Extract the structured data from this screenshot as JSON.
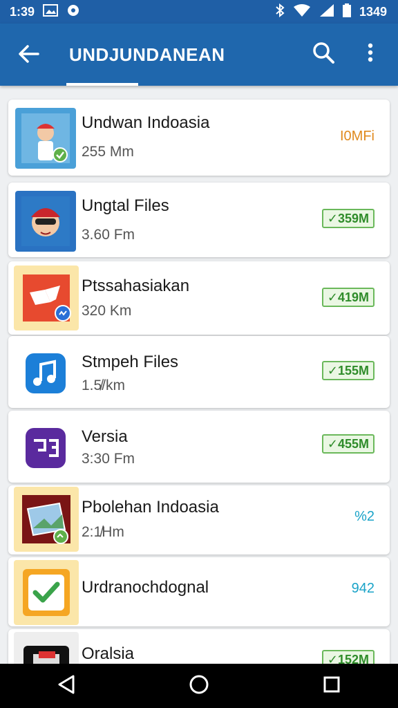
{
  "status_bar": {
    "time": "1:39",
    "battery_text": "1349",
    "icons": [
      "image-icon",
      "record-icon",
      "bluetooth-icon",
      "wifi-icon",
      "signal-icon",
      "battery-icon"
    ]
  },
  "app_bar": {
    "title": "UNDJUNDANEAN",
    "icons": [
      "back-arrow-icon",
      "search-icon",
      "more-vert-icon"
    ]
  },
  "items": [
    {
      "name": "Undwan Indoasia",
      "meta": "255 Mm",
      "size": "I0MFi",
      "size_style": "orange",
      "icon": "character-app-icon"
    },
    {
      "name": "Ungtal Files",
      "meta": "3.60 Fm",
      "size": "✓359M",
      "size_style": "badge",
      "icon": "character-app-icon"
    },
    {
      "name": "Ptssahasiakan",
      "meta": "320 Km",
      "size": "✓419M",
      "size_style": "badge",
      "icon": "red-flag-app-icon"
    },
    {
      "name": "Stmpeh Files",
      "meta": "1.5̸/km",
      "size": "✓155M",
      "size_style": "badge",
      "icon": "music-note-icon"
    },
    {
      "name": "Versia",
      "meta": "3:30 Fm",
      "size": "✓455M",
      "size_style": "badge",
      "icon": "purple-app-icon"
    },
    {
      "name": "Pbolehan Indoasia",
      "meta": "2:1̸Hm",
      "size": "%2",
      "size_style": "teal",
      "icon": "photo-app-icon"
    },
    {
      "name": "Urdranochdognal",
      "meta": "",
      "size": "942",
      "size_style": "teal",
      "icon": "checkmark-app-icon"
    },
    {
      "name": "Oralsia",
      "meta": "",
      "size": "✓152M",
      "size_style": "badge",
      "icon": "dark-app-icon"
    }
  ],
  "nav_bar": {
    "icons": [
      "back-triangle-icon",
      "home-circle-icon",
      "recents-square-icon"
    ]
  },
  "colors": {
    "primary": "#1f67ad",
    "status_bar": "#1f5fa6",
    "badge_green": "#2f8c2a",
    "accent_orange": "#e08a1e",
    "accent_teal": "#1aa3c8"
  }
}
